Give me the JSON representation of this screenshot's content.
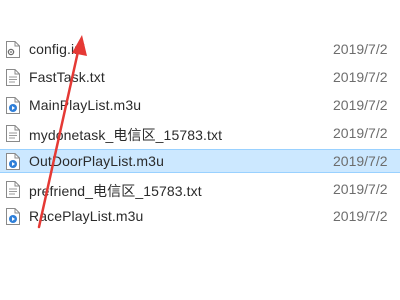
{
  "files": [
    {
      "name": "config.ini",
      "date": "2019/7/2",
      "icon": "settings-file-icon"
    },
    {
      "name": "FastTask.txt",
      "date": "2019/7/2",
      "icon": "text-file-icon"
    },
    {
      "name": "MainPlayList.m3u",
      "date": "2019/7/2",
      "icon": "playlist-file-icon"
    },
    {
      "name": "mydonetask_电信区_15783.txt",
      "date": "2019/7/2",
      "icon": "text-file-icon"
    },
    {
      "name": "OutDoorPlayList.m3u",
      "date": "2019/7/2",
      "icon": "playlist-file-icon",
      "selected": true
    },
    {
      "name": "prefriend_电信区_15783.txt",
      "date": "2019/7/2",
      "icon": "text-file-icon"
    },
    {
      "name": "RacePlayList.m3u",
      "date": "2019/7/2",
      "icon": "playlist-file-icon"
    }
  ],
  "annotation": {
    "arrow_color": "#e53935"
  },
  "colors": {
    "selected_background": "#cce8ff",
    "selected_border": "#99d1ff"
  }
}
